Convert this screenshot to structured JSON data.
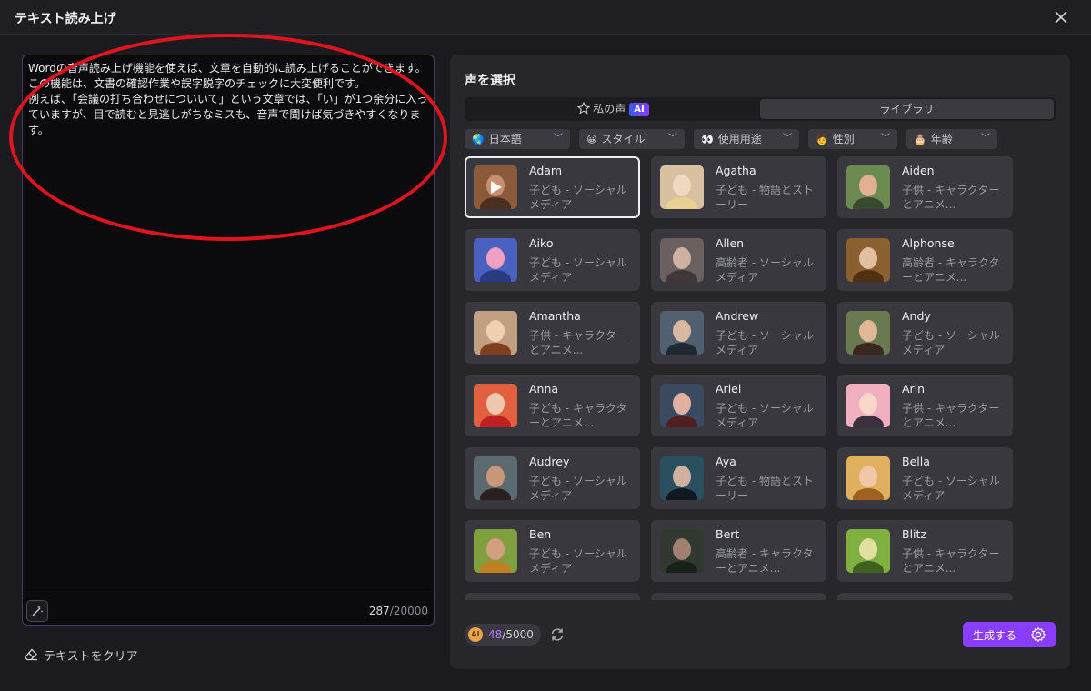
{
  "window": {
    "title": "テキスト読み上げ"
  },
  "editor": {
    "text": "Wordの音声読み上げ機能を使えば、文章を自動的に読み上げることができます。この機能は、文書の確認作業や誤字脱字のチェックに大変便利です。\n例えば、「会議の打ち合わせについいて」という文章では、「い」が1つ余分に入っていますが、目で読むと見逃しがちなミスも、音声で聞けば気づきやすくなります。",
    "char_count": "287",
    "char_limit": "/20000"
  },
  "clear_label": "テキストをクリア",
  "voice_panel": {
    "title": "声を選択",
    "tabs": [
      {
        "label": "私の声",
        "badge": "AI"
      },
      {
        "label": "ライブラリ"
      }
    ],
    "filters": [
      {
        "label": "日本語",
        "icon": "globe-icon"
      },
      {
        "label": "スタイル",
        "icon": "smile-icon"
      },
      {
        "label": "使用用途",
        "icon": "eyes-icon"
      },
      {
        "label": "性別",
        "icon": "person-icon"
      },
      {
        "label": "年齢",
        "icon": "cake-icon"
      }
    ],
    "voices": [
      {
        "name": "Adam",
        "desc": "子ども - ソーシャルメディア",
        "selected": true,
        "colors": [
          "#8a5a3a",
          "#c89070",
          "#4a3020"
        ]
      },
      {
        "name": "Agatha",
        "desc": "子ども - 物語とストーリー",
        "colors": [
          "#d8c0a0",
          "#f0d8c0",
          "#e8d090"
        ]
      },
      {
        "name": "Aiden",
        "desc": "子供 - キャラクターとアニメ...",
        "colors": [
          "#6a8a50",
          "#e0b090",
          "#3a4a30"
        ]
      },
      {
        "name": "Aiko",
        "desc": "子ども - ソーシャルメディア",
        "colors": [
          "#4a60c0",
          "#f0a0c0",
          "#2a3a80"
        ]
      },
      {
        "name": "Allen",
        "desc": "高齢者 - ソーシャルメディア",
        "colors": [
          "#6a6060",
          "#d0b0a0",
          "#403838"
        ]
      },
      {
        "name": "Alphonse",
        "desc": "高齢者 - キャラクターとアニメ...",
        "colors": [
          "#8a6030",
          "#e0c0a0",
          "#503010"
        ]
      },
      {
        "name": "Amantha",
        "desc": "子供 - キャラクターとアニメ...",
        "colors": [
          "#c0a080",
          "#f0d0b0",
          "#804020"
        ]
      },
      {
        "name": "Andrew",
        "desc": "子ども - ソーシャルメディア",
        "colors": [
          "#506070",
          "#d8b8a0",
          "#202830"
        ]
      },
      {
        "name": "Andy",
        "desc": "子ども - ソーシャルメディア",
        "colors": [
          "#6a7a50",
          "#e0b898",
          "#3a2820"
        ]
      },
      {
        "name": "Anna",
        "desc": "子ども - キャラクターとアニメ...",
        "colors": [
          "#e06040",
          "#f0c8b0",
          "#c02020"
        ]
      },
      {
        "name": "Ariel",
        "desc": "子ども - ソーシャルメディア",
        "colors": [
          "#3a4a60",
          "#e0b0a0",
          "#502020"
        ]
      },
      {
        "name": "Arin",
        "desc": "子供 - キャラクターとアニメ...",
        "colors": [
          "#f0b0c0",
          "#f8d8c8",
          "#3a3040"
        ]
      },
      {
        "name": "Audrey",
        "desc": "子ども - ソーシャルメディア",
        "colors": [
          "#5a6a70",
          "#c89878",
          "#2a2020"
        ]
      },
      {
        "name": "Aya",
        "desc": "子ども - 物語とストーリー",
        "colors": [
          "#2a5060",
          "#d0b0a0",
          "#101820"
        ]
      },
      {
        "name": "Bella",
        "desc": "子ども - ソーシャルメディア",
        "colors": [
          "#e0b060",
          "#f0c8a8",
          "#a06020"
        ]
      },
      {
        "name": "Ben",
        "desc": "子ども - ソーシャルメディア",
        "colors": [
          "#80a040",
          "#d0a080",
          "#c08020"
        ]
      },
      {
        "name": "Bert",
        "desc": "高齢者 - キャラクターとアニメ...",
        "colors": [
          "#303830",
          "#a08070",
          "#182018"
        ]
      },
      {
        "name": "Blitz",
        "desc": "子供 - キャラクターとアニメ...",
        "colors": [
          "#80b040",
          "#e0e0a0",
          "#406020"
        ]
      }
    ]
  },
  "footer": {
    "coin_label": "AI",
    "credits_used": "48",
    "credits_total": "/5000",
    "generate_label": "生成する"
  }
}
